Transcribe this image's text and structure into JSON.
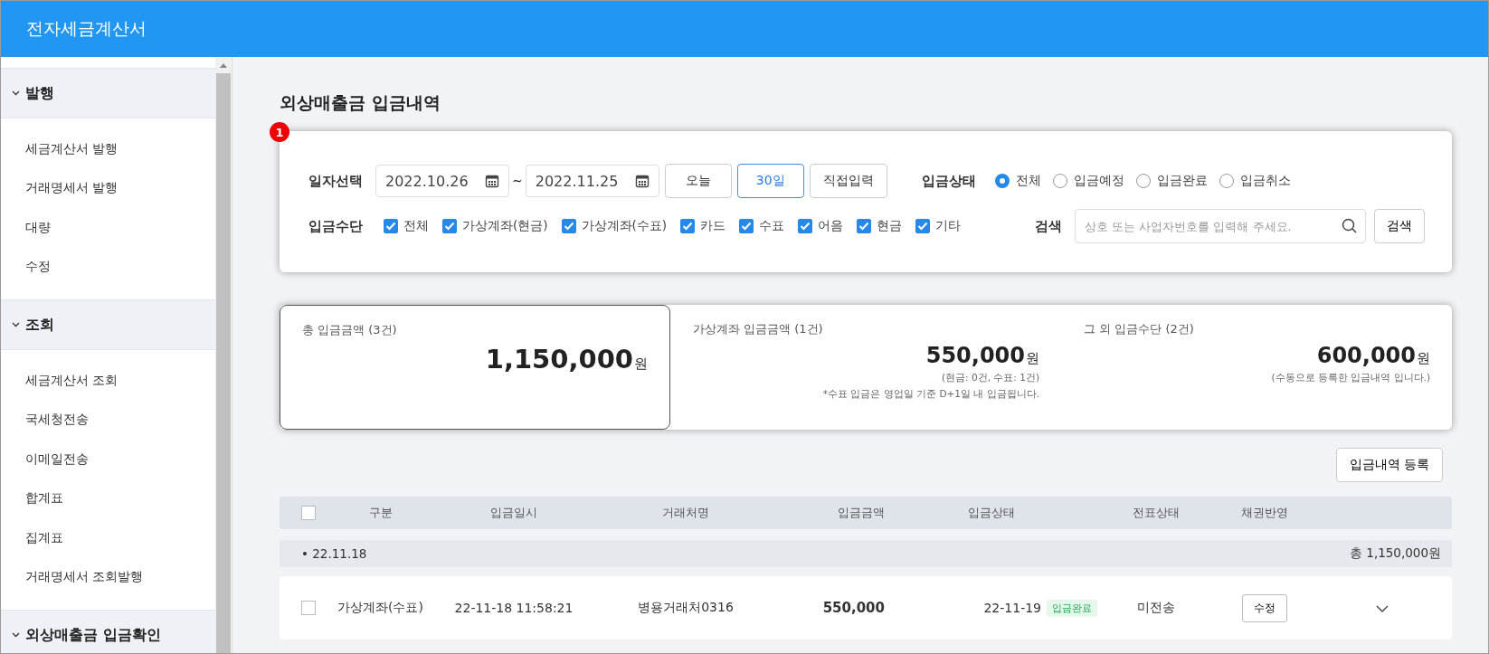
{
  "header": {
    "title": "전자세금계산서"
  },
  "sidebar": {
    "groups": [
      {
        "label": "발행",
        "expanded": true,
        "items": [
          {
            "label": "세금계산서 발행"
          },
          {
            "label": "거래명세서 발행"
          },
          {
            "label": "대량"
          },
          {
            "label": "수정"
          }
        ]
      },
      {
        "label": "조회",
        "expanded": true,
        "items": [
          {
            "label": "세금계산서 조회"
          },
          {
            "label": "국세청전송"
          },
          {
            "label": "이메일전송"
          },
          {
            "label": "합계표"
          },
          {
            "label": "집계표"
          },
          {
            "label": "거래명세서 조회발행"
          }
        ]
      },
      {
        "label": "외상매출금 입금확인",
        "expanded": true
      }
    ]
  },
  "page_title": "외상매출금 입금내역",
  "marker": "1",
  "filters": {
    "date": {
      "label": "일자선택",
      "from": "2022.10.26",
      "separator": "~",
      "to": "2022.11.25",
      "presets": [
        {
          "label": "오늘",
          "selected": false
        },
        {
          "label": "30일",
          "selected": true
        },
        {
          "label": "직접입력",
          "selected": false
        }
      ]
    },
    "status": {
      "label": "입금상태",
      "options": [
        {
          "label": "전체",
          "selected": true
        },
        {
          "label": "입금예정",
          "selected": false
        },
        {
          "label": "입금완료",
          "selected": false
        },
        {
          "label": "입금취소",
          "selected": false
        }
      ]
    },
    "method": {
      "label": "입금수단",
      "options": [
        {
          "label": "전체",
          "checked": true
        },
        {
          "label": "가상계좌(현금)",
          "checked": true
        },
        {
          "label": "가상계좌(수표)",
          "checked": true
        },
        {
          "label": "카드",
          "checked": true
        },
        {
          "label": "수표",
          "checked": true
        },
        {
          "label": "어음",
          "checked": true
        },
        {
          "label": "현금",
          "checked": true
        },
        {
          "label": "기타",
          "checked": true
        }
      ]
    },
    "search": {
      "label": "검색",
      "placeholder": "상호 또는 사업자번호를 입력해 주세요.",
      "button": "검색"
    }
  },
  "summary": [
    {
      "label": "총 입금금액 (3건)",
      "amount": "1,150,000",
      "unit": "원",
      "selected": true
    },
    {
      "label": "가상계좌 입금금액 (1건)",
      "amount": "550,000",
      "unit": "원",
      "notes": [
        "(현금: 0건, 수표: 1건)",
        "*수표 입금은 영업일 기준 D+1일 내 입금됩니다."
      ],
      "selected": false
    },
    {
      "label": "그 외 입금수단 (2건)",
      "amount": "600,000",
      "unit": "원",
      "notes": [
        "(수동으로 등록한 입금내역 입니다.)"
      ],
      "selected": false
    }
  ],
  "register_button": "입금내역 등록",
  "table": {
    "columns": [
      "구분",
      "입금일시",
      "거래처명",
      "입금금액",
      "입금상태",
      "전표상태",
      "채권반영"
    ],
    "all_checked": false,
    "groups": [
      {
        "date": "• 22.11.18",
        "total": "총 1,150,000원",
        "rows": [
          {
            "checked": false,
            "type": "가상계좌(수표)",
            "datetime": "22-11-18 11:58:21",
            "client": "병용거래처0316",
            "amount": "550,000",
            "status_date": "22-11-19",
            "status": "입금완료",
            "voucher": "미전송",
            "action": "수정",
            "expanded": false
          }
        ]
      }
    ]
  }
}
